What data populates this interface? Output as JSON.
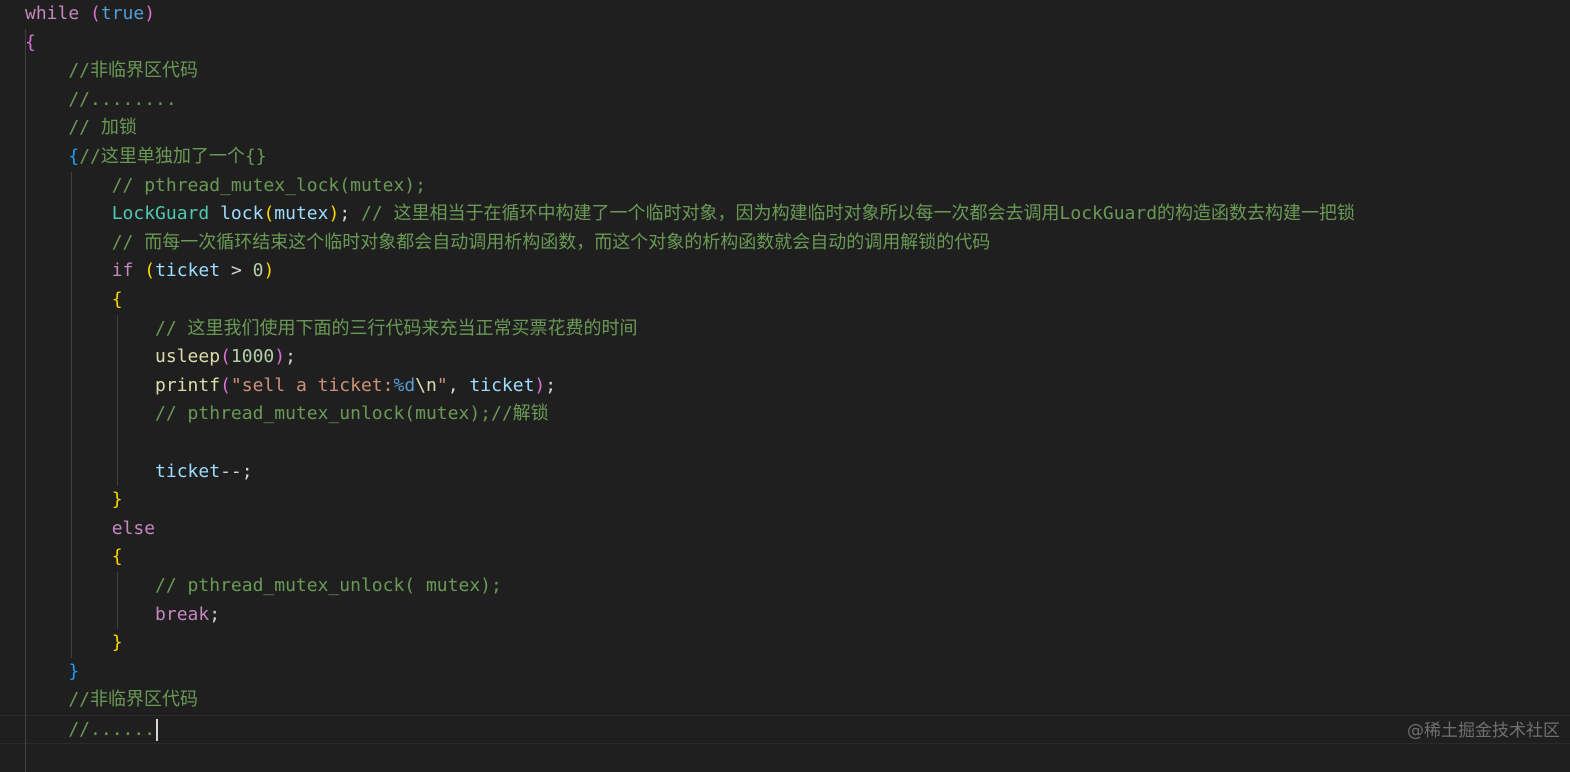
{
  "editor": {
    "theme_colors": {
      "background": "#1f1f1f",
      "keyword": "#c586c0",
      "constant": "#569cd6",
      "type": "#4ec9b0",
      "function": "#dcdcaa",
      "variable": "#9cdcfe",
      "number": "#b5cea8",
      "string": "#ce9178",
      "comment": "#6a9955",
      "bracket_1": "#ffd700",
      "bracket_2": "#da70d6",
      "bracket_3": "#179fff",
      "plain": "#d4d4d4"
    },
    "lines": [
      [
        {
          "t": "while",
          "c": "keyword"
        },
        {
          "t": " ",
          "c": "plain"
        },
        {
          "t": "(",
          "c": "bracket_2"
        },
        {
          "t": "true",
          "c": "constant"
        },
        {
          "t": ")",
          "c": "bracket_2"
        }
      ],
      [
        {
          "t": "{",
          "c": "bracket_2"
        }
      ],
      [
        {
          "t": "    //非临界区代码",
          "c": "comment"
        }
      ],
      [
        {
          "t": "    //........",
          "c": "comment"
        }
      ],
      [
        {
          "t": "    // 加锁",
          "c": "comment"
        }
      ],
      [
        {
          "t": "    ",
          "c": "plain"
        },
        {
          "t": "{",
          "c": "bracket_3"
        },
        {
          "t": "//这里单独加了一个{}",
          "c": "comment"
        }
      ],
      [
        {
          "t": "        // pthread_mutex_lock(mutex);",
          "c": "comment"
        }
      ],
      [
        {
          "t": "        ",
          "c": "plain"
        },
        {
          "t": "LockGuard",
          "c": "type"
        },
        {
          "t": " ",
          "c": "plain"
        },
        {
          "t": "lock",
          "c": "variable"
        },
        {
          "t": "(",
          "c": "bracket_1"
        },
        {
          "t": "mutex",
          "c": "variable"
        },
        {
          "t": ")",
          "c": "bracket_1"
        },
        {
          "t": "; ",
          "c": "plain"
        },
        {
          "t": "// 这里相当于在循环中构建了一个临时对象，因为构建临时对象所以每一次都会去调用LockGuard的构造函数去构建一把锁",
          "c": "comment"
        }
      ],
      [
        {
          "t": "        // 而每一次循环结束这个临时对象都会自动调用析构函数，而这个对象的析构函数就会自动的调用解锁的代码",
          "c": "comment"
        }
      ],
      [
        {
          "t": "        ",
          "c": "plain"
        },
        {
          "t": "if",
          "c": "keyword"
        },
        {
          "t": " ",
          "c": "plain"
        },
        {
          "t": "(",
          "c": "bracket_1"
        },
        {
          "t": "ticket",
          "c": "variable"
        },
        {
          "t": " > ",
          "c": "plain"
        },
        {
          "t": "0",
          "c": "number"
        },
        {
          "t": ")",
          "c": "bracket_1"
        }
      ],
      [
        {
          "t": "        ",
          "c": "plain"
        },
        {
          "t": "{",
          "c": "bracket_1"
        }
      ],
      [
        {
          "t": "            // 这里我们使用下面的三行代码来充当正常买票花费的时间",
          "c": "comment"
        }
      ],
      [
        {
          "t": "            ",
          "c": "plain"
        },
        {
          "t": "usleep",
          "c": "function"
        },
        {
          "t": "(",
          "c": "bracket_2"
        },
        {
          "t": "1000",
          "c": "number"
        },
        {
          "t": ")",
          "c": "bracket_2"
        },
        {
          "t": ";",
          "c": "plain"
        }
      ],
      [
        {
          "t": "            ",
          "c": "plain"
        },
        {
          "t": "printf",
          "c": "function"
        },
        {
          "t": "(",
          "c": "bracket_2"
        },
        {
          "t": "\"sell a ticket:",
          "c": "string"
        },
        {
          "t": "%d",
          "c": "constant"
        },
        {
          "t": "\\n",
          "c": "function"
        },
        {
          "t": "\"",
          "c": "string"
        },
        {
          "t": ", ",
          "c": "plain"
        },
        {
          "t": "ticket",
          "c": "variable"
        },
        {
          "t": ")",
          "c": "bracket_2"
        },
        {
          "t": ";",
          "c": "plain"
        }
      ],
      [
        {
          "t": "            // pthread_mutex_unlock(mutex);//解锁",
          "c": "comment"
        }
      ],
      [],
      [
        {
          "t": "            ",
          "c": "plain"
        },
        {
          "t": "ticket",
          "c": "variable"
        },
        {
          "t": "--;",
          "c": "plain"
        }
      ],
      [
        {
          "t": "        ",
          "c": "plain"
        },
        {
          "t": "}",
          "c": "bracket_1"
        }
      ],
      [
        {
          "t": "        ",
          "c": "plain"
        },
        {
          "t": "else",
          "c": "keyword"
        }
      ],
      [
        {
          "t": "        ",
          "c": "plain"
        },
        {
          "t": "{",
          "c": "bracket_1"
        }
      ],
      [
        {
          "t": "            // pthread_mutex_unlock( mutex);",
          "c": "comment"
        }
      ],
      [
        {
          "t": "            ",
          "c": "plain"
        },
        {
          "t": "break",
          "c": "keyword"
        },
        {
          "t": ";",
          "c": "plain"
        }
      ],
      [
        {
          "t": "        ",
          "c": "plain"
        },
        {
          "t": "}",
          "c": "bracket_1"
        }
      ],
      [
        {
          "t": "    ",
          "c": "plain"
        },
        {
          "t": "}",
          "c": "bracket_3"
        }
      ],
      [
        {
          "t": "    //非临界区代码",
          "c": "comment"
        }
      ],
      [
        {
          "t": "    //......",
          "c": "comment"
        }
      ]
    ],
    "cursor_line": 25,
    "cut_off_closing_brace": "}"
  },
  "watermark": "@稀土掘金技术社区"
}
